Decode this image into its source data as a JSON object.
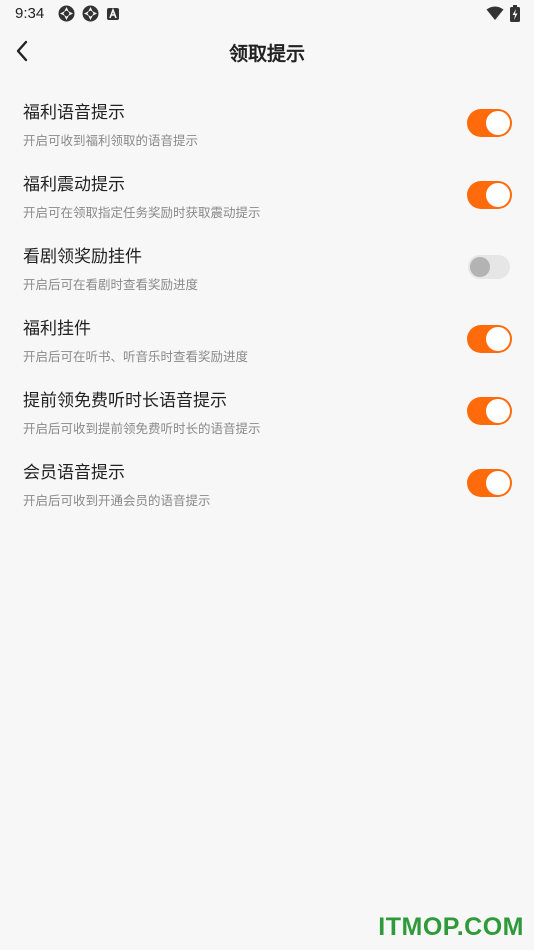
{
  "status_bar": {
    "time": "9:34",
    "left_icons": [
      "app-notification-icon",
      "app-notification-icon",
      "a-letter-icon"
    ],
    "right_icons": [
      "wifi-icon",
      "battery-charging-icon"
    ]
  },
  "header": {
    "title": "领取提示",
    "back_icon": "chevron-left-icon"
  },
  "settings": [
    {
      "title": "福利语音提示",
      "description": "开启可收到福利领取的语音提示",
      "enabled": true
    },
    {
      "title": "福利震动提示",
      "description": "开启可在领取指定任务奖励时获取震动提示",
      "enabled": true
    },
    {
      "title": "看剧领奖励挂件",
      "description": "开启后可在看剧时查看奖励进度",
      "enabled": false
    },
    {
      "title": "福利挂件",
      "description": "开启后可在听书、听音乐时查看奖励进度",
      "enabled": true
    },
    {
      "title": "提前领免费听时长语音提示",
      "description": "开启后可收到提前领免费听时长的语音提示",
      "enabled": true
    },
    {
      "title": "会员语音提示",
      "description": "开启后可收到开通会员的语音提示",
      "enabled": true
    }
  ],
  "colors": {
    "accent": "#ff6a0b",
    "toggle_off": "#e6e6e6",
    "watermark": "#2e9a3a"
  },
  "watermark": "ITMOP.COM"
}
